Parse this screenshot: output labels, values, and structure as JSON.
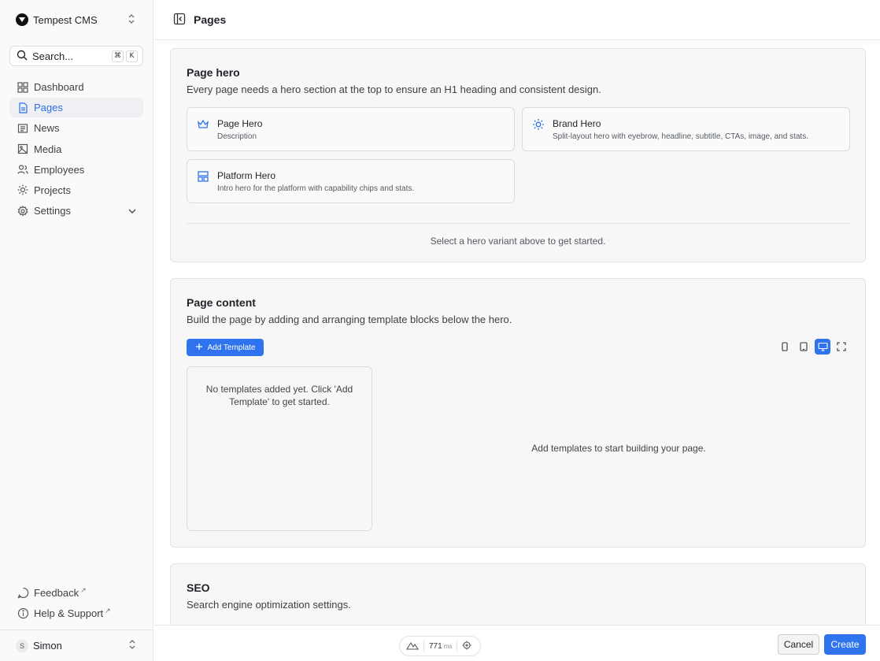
{
  "app": {
    "name": "Tempest CMS"
  },
  "search": {
    "label": "Search...",
    "shortcut": [
      "⌘",
      "K"
    ]
  },
  "sidebar": {
    "items": [
      {
        "label": "Dashboard",
        "icon": "dashboard-icon"
      },
      {
        "label": "Pages",
        "icon": "page-icon",
        "active": true
      },
      {
        "label": "News",
        "icon": "newspaper-icon"
      },
      {
        "label": "Media",
        "icon": "image-icon"
      },
      {
        "label": "Employees",
        "icon": "users-icon"
      },
      {
        "label": "Projects",
        "icon": "sun-icon"
      },
      {
        "label": "Settings",
        "icon": "gear-icon",
        "expandable": true
      }
    ],
    "footer": [
      {
        "label": "Feedback",
        "icon": "chat-icon"
      },
      {
        "label": "Help & Support",
        "icon": "info-icon"
      }
    ],
    "user": {
      "initial": "S",
      "name": "Simon"
    }
  },
  "header": {
    "title": "Pages"
  },
  "hero_section": {
    "title": "Page hero",
    "subtitle": "Every page needs a hero section at the top to ensure an H1 heading and consistent design.",
    "options": [
      {
        "title": "Page Hero",
        "description": "Description",
        "icon": "crown-icon"
      },
      {
        "title": "Brand Hero",
        "description": "Split-layout hero with eyebrow, headline, subtitle, CTAs, image, and stats.",
        "icon": "sun-icon"
      },
      {
        "title": "Platform Hero",
        "description": "Intro hero for the platform with capability chips and stats.",
        "icon": "layout-icon"
      }
    ],
    "hint": "Select a hero variant above to get started."
  },
  "content_section": {
    "title": "Page content",
    "subtitle": "Build the page by adding and arranging template blocks below the hero.",
    "add_button": "Add Template",
    "empty_list": "No templates added yet. Click 'Add Template' to get started.",
    "preview_empty": "Add templates to start building your page.",
    "view_modes": [
      "mobile",
      "tablet",
      "desktop",
      "fullscreen"
    ],
    "active_view": "desktop"
  },
  "seo_section": {
    "title": "SEO",
    "subtitle": "Search engine optimization settings."
  },
  "perf": {
    "value": "771",
    "unit": "ms"
  },
  "actions": {
    "cancel": "Cancel",
    "create": "Create"
  },
  "colors": {
    "accent": "#2f74ee"
  }
}
